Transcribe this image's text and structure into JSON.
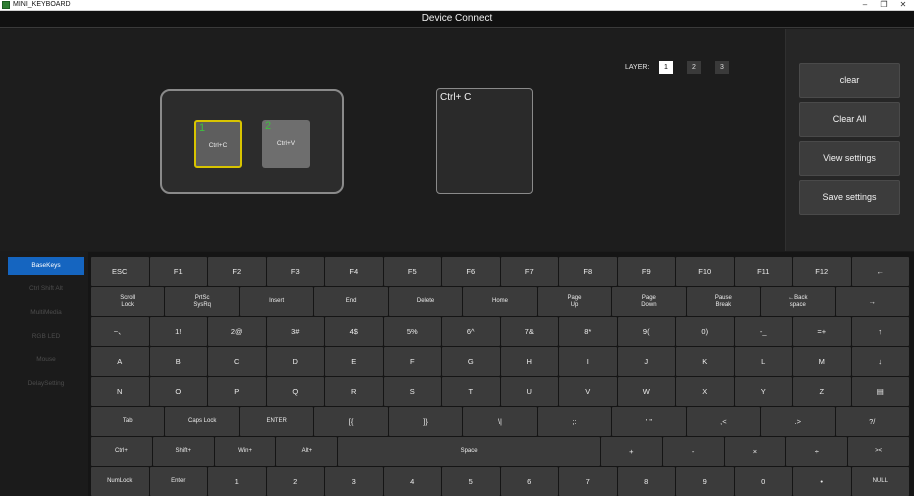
{
  "window": {
    "app_title": "MINI_KEYBOARD",
    "minimize": "–",
    "maximize": "❐",
    "close": "✕"
  },
  "header": {
    "title": "Device Connect"
  },
  "layers": {
    "label": "LAYER:",
    "buttons": [
      "1",
      "2",
      "3"
    ],
    "active": "1"
  },
  "device": {
    "keys": [
      {
        "num": "1",
        "label": "Ctrl+C",
        "selected": true
      },
      {
        "num": "2",
        "label": "Ctrl+V",
        "selected": false
      }
    ]
  },
  "assignment": {
    "text": "Ctrl+ C"
  },
  "side_panel": {
    "buttons": [
      "clear",
      "Clear All",
      "View settings",
      "Save settings"
    ]
  },
  "nav": {
    "items": [
      "BaseKeys",
      "Ctrl Shift Alt",
      "MultiMedia",
      "RGB LED",
      "Mouse",
      "DelaySetting"
    ],
    "active": "BaseKeys"
  },
  "keyboard": {
    "rows": [
      [
        "ESC",
        "F1",
        "F2",
        "F3",
        "F4",
        "F5",
        "F6",
        "F7",
        "F8",
        "F9",
        "F10",
        "F11",
        "F12",
        "←"
      ],
      [
        "Scroll\nLock",
        "PrtSc\nSysRq",
        "Insert",
        "End",
        "Delete",
        "Home",
        "Page\nUp",
        "Page\nDown",
        "Pause\nBreak",
        "←Back\nspace",
        "→"
      ],
      [
        "~、",
        "1!",
        "2@",
        "3#",
        "4$",
        "5%",
        "6^",
        "7&",
        "8*",
        "9(",
        "0)",
        "-_",
        "=+",
        "↑"
      ],
      [
        "A",
        "B",
        "C",
        "D",
        "E",
        "F",
        "G",
        "H",
        "I",
        "J",
        "K",
        "L",
        "M",
        "↓"
      ],
      [
        "N",
        "O",
        "P",
        "Q",
        "R",
        "S",
        "T",
        "U",
        "V",
        "W",
        "X",
        "Y",
        "Z",
        "▤"
      ],
      [
        "Tab",
        "Caps Lock",
        "ENTER",
        "[{",
        "]}",
        "\\|",
        ";:",
        "' \"",
        ",<",
        ".>",
        "?/"
      ],
      [
        "Ctrl+",
        "Shift+",
        "Win+",
        "Alt+",
        "Space",
        "+",
        "-",
        "×",
        "÷",
        "><"
      ],
      [
        "NumLock",
        "Enter",
        "1",
        "2",
        "3",
        "4",
        "5",
        "6",
        "7",
        "8",
        "9",
        "0",
        "•",
        "NULL"
      ]
    ]
  },
  "colors": {
    "accent_blue": "#1565c0",
    "selected_key_border": "#d8c400",
    "key_number_green": "#3fbf3f"
  }
}
